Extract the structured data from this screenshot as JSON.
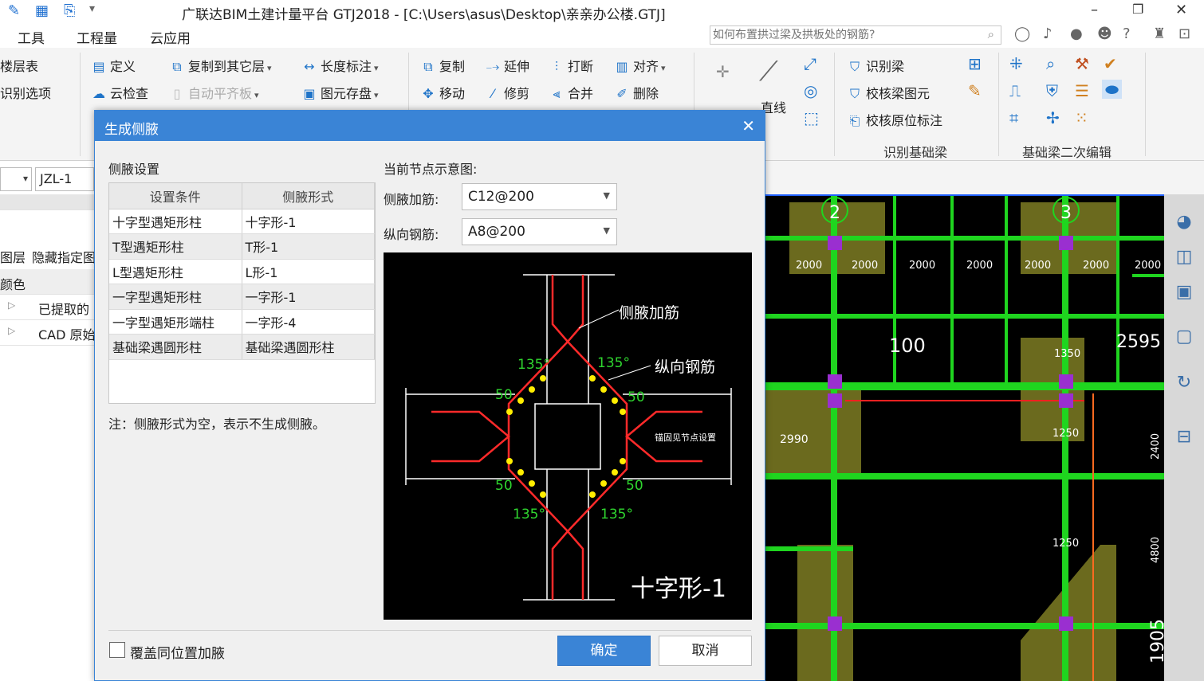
{
  "window": {
    "title": "广联达BIM土建计量平台 GTJ2018 - [C:\\Users\\asus\\Desktop\\亲亲办公楼.GTJ]",
    "min": "–",
    "restore": "❐",
    "close": "✕"
  },
  "menu": {
    "items": [
      "工具",
      "工程量",
      "云应用"
    ],
    "search_placeholder": "如何布置拱过梁及拱板处的钢筋?",
    "help": "?"
  },
  "ribbon": {
    "left": [
      "楼层表",
      "识别选项"
    ],
    "define": "定义",
    "cloud_check": "云检查",
    "copy_floor": "复制到其它层",
    "auto_slab": "自动平齐板",
    "length_dim": "长度标注",
    "elem_save": "图元存盘",
    "copy": "复制",
    "extend": "延伸",
    "break": "打断",
    "align": "对齐",
    "move": "移动",
    "trim": "修剪",
    "merge": "合并",
    "delete": "删除",
    "line": "直线",
    "identify_beam": "识别梁",
    "check_beam_elem": "校核梁图元",
    "check_orig_label": "校核原位标注",
    "group_identify": "识别基础梁",
    "group_edit": "基础梁二次编辑"
  },
  "left_panel": {
    "name": "JZL-1",
    "layer": "图层",
    "hide": "隐藏指定图",
    "color": "颜色",
    "extracted": "已提取的",
    "cad": "CAD 原始"
  },
  "canvas": {
    "grid_2": "2",
    "grid_3": "3",
    "dims": [
      "2000",
      "2000",
      "2000",
      "2000",
      "2000",
      "2000",
      "2000"
    ],
    "big_dim": "100",
    "right_dim": "2595",
    "d1350": "1350",
    "d2990": "2990",
    "d1250a": "1250",
    "d1250b": "1250",
    "d2400": "2400",
    "d4800": "4800",
    "d1905": "1905"
  },
  "dialog": {
    "title": "生成侧腋",
    "section": "侧腋设置",
    "columns": [
      "设置条件",
      "侧腋形式"
    ],
    "rows": [
      [
        "十字型遇矩形柱",
        "十字形-1"
      ],
      [
        "T型遇矩形柱",
        "T形-1"
      ],
      [
        "L型遇矩形柱",
        "L形-1"
      ],
      [
        "一字型遇矩形柱",
        "一字形-1"
      ],
      [
        "一字型遇矩形端柱",
        "一字形-4"
      ],
      [
        "基础梁遇圆形柱",
        "基础梁遇圆形柱"
      ]
    ],
    "note": "注：侧腋形式为空，表示不生成侧腋。",
    "diagram_label": "当前节点示意图:",
    "haunch_rebar_label": "侧腋加筋:",
    "haunch_rebar_value": "C12@200",
    "long_rebar_label": "纵向钢筋:",
    "long_rebar_value": "A8@200",
    "overwrite_label": "覆盖同位置加腋",
    "ok": "确定",
    "cancel": "取消"
  },
  "diagram": {
    "callout_haunch": "侧腋加筋",
    "callout_long": "纵向钢筋",
    "anchor_note": "锚固见节点设置",
    "angle": "135°",
    "offset": "50",
    "caption": "十字形-1"
  }
}
